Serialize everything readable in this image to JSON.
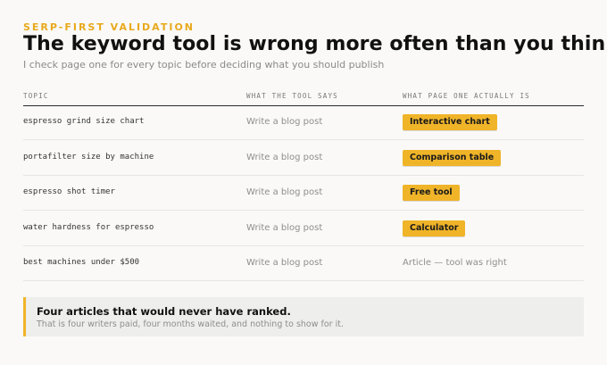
{
  "header": {
    "eyebrow": "SERP-FIRST VALIDATION",
    "title": "The keyword tool is wrong more often than you think",
    "subtitle": "I check page one for every topic before deciding what you should publish"
  },
  "table": {
    "columns": [
      "TOPIC",
      "WHAT THE TOOL SAYS",
      "WHAT PAGE ONE ACTUALLY IS"
    ],
    "rows": [
      {
        "topic": "espresso grind size chart",
        "tool": "Write a blog post",
        "actual": "Interactive chart",
        "highlight": true
      },
      {
        "topic": "portafilter size by machine",
        "tool": "Write a blog post",
        "actual": "Comparison table",
        "highlight": true
      },
      {
        "topic": "espresso shot timer",
        "tool": "Write a blog post",
        "actual": "Free tool",
        "highlight": true
      },
      {
        "topic": "water hardness for espresso",
        "tool": "Write a blog post",
        "actual": "Calculator",
        "highlight": true
      },
      {
        "topic": "best machines under $500",
        "tool": "Write a blog post",
        "actual": "Article — tool was right",
        "highlight": false
      }
    ]
  },
  "callout": {
    "title": "Four articles that would never have ranked.",
    "text": "That is four writers paid, four months waited, and nothing to show for it."
  },
  "colors": {
    "accent": "#f0b429",
    "eyebrow": "#e8a91c",
    "background": "#faf9f7",
    "muted": "#8e8e8e"
  }
}
